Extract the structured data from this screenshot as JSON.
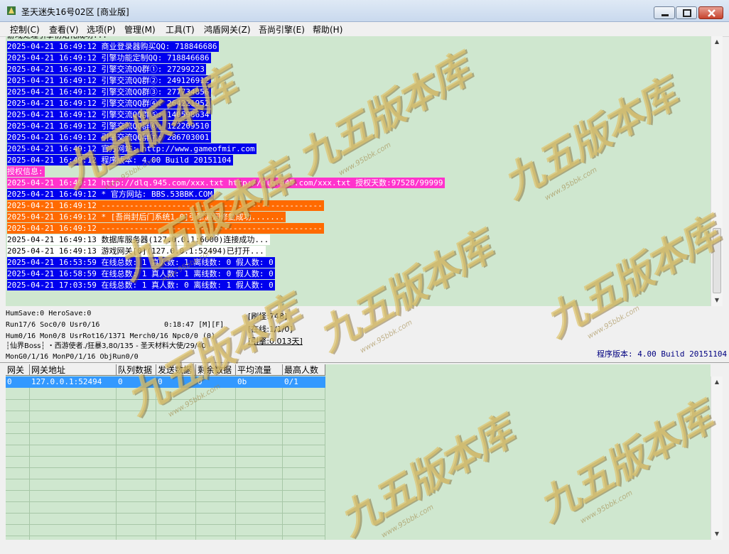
{
  "window": {
    "title": "圣天迷失16号02区 [商业版]"
  },
  "menu": [
    "控制(C)",
    "查看(V)",
    "选项(P)",
    "管理(M)",
    "工具(T)",
    "鸿盾网关(Z)",
    "吾尚引擎(E)",
    "帮助(H)"
  ],
  "log": [
    {
      "text": "游戏处理引擎初始化成功...",
      "bg": "#cfe7cf",
      "fg": "#000000",
      "cut": true
    },
    {
      "text": "2025-04-21 16:49:12 商业登录器购买QQ: 718846686",
      "bg": "#0000ee",
      "fg": "#ffffff"
    },
    {
      "text": "2025-04-21 16:49:12 引擎功能定制QQ: 718846686",
      "bg": "#0000ee",
      "fg": "#ffffff"
    },
    {
      "text": "2025-04-21 16:49:12 引擎交流QQ群①: 27299223",
      "bg": "#0000ee",
      "fg": "#ffffff"
    },
    {
      "text": "2025-04-21 16:49:12 引擎交流QQ群②: 249126912",
      "bg": "#0000ee",
      "fg": "#ffffff"
    },
    {
      "text": "2025-04-21 16:49:12 引擎交流QQ群③: 277734856",
      "bg": "#0000ee",
      "fg": "#ffffff"
    },
    {
      "text": "2025-04-21 16:49:12 引擎交流QQ群④: 264221952",
      "bg": "#0000ee",
      "fg": "#ffffff"
    },
    {
      "text": "2025-04-21 16:49:12 引擎交流QQ群⑤: 140598634",
      "bg": "#0000ee",
      "fg": "#ffffff"
    },
    {
      "text": "2025-04-21 16:49:12 引擎交流QQ群⑥: 122209510",
      "bg": "#0000ee",
      "fg": "#ffffff"
    },
    {
      "text": "2025-04-21 16:49:12 引擎交流QQ群⑦: 286703001",
      "bg": "#0000ee",
      "fg": "#ffffff"
    },
    {
      "text": "2025-04-21 16:49:12 官方网站: http://www.gameofmir.com",
      "bg": "#0000ee",
      "fg": "#ffffff"
    },
    {
      "text": "2025-04-21 16:49:12 程序版本: 4.00 Build 20151104",
      "bg": "#0000ee",
      "fg": "#ffffff"
    },
    {
      "text": "授权信息:",
      "bg": "#ff33cc",
      "fg": "#ffffff"
    },
    {
      "text": "2025-04-21 16:49:12 http://dlq.945.com/xxx.txt http://dlq.945.com/xxx.txt 授权天数:97528/99999",
      "bg": "#ff33cc",
      "fg": "#ffffff"
    },
    {
      "text": "2025-04-21 16:49:12 * 官方网站: BBS.53BBK.COM",
      "bg": "#0000ee",
      "fg": "#ffffff"
    },
    {
      "text": "2025-04-21 16:49:12 -----------------------------------------------",
      "bg": "#ff6a00",
      "fg": "#ffffff"
    },
    {
      "text": "2025-04-21 16:49:12 * [吾尚封后门系统1.0]引擎漏洞修复成功.......",
      "bg": "#ff6a00",
      "fg": "#ffffff"
    },
    {
      "text": "2025-04-21 16:49:12 -----------------------------------------------",
      "bg": "#ff6a00",
      "fg": "#ffffff"
    },
    {
      "text": "2025-04-21 16:49:13 数据库服务器(127.0.0.1:6000)连接成功...",
      "bg": "#ffffff",
      "fg": "#000000"
    },
    {
      "text": "2025-04-21 16:49:13 游戏网关[0](127.0.0.1:52494)已打开...",
      "bg": "#ffffff",
      "fg": "#000000"
    },
    {
      "text": "2025-04-21 16:53:59 在线总数: 1 真人数: 1 离线数: 0 假人数: 0",
      "bg": "#0000ee",
      "fg": "#ffffff"
    },
    {
      "text": "2025-04-21 16:58:59 在线总数: 1 真人数: 1 离线数: 0 假人数: 0",
      "bg": "#0000ee",
      "fg": "#ffffff"
    },
    {
      "text": "2025-04-21 17:03:59 在线总数: 1 真人数: 0 离线数: 1 假人数: 0",
      "bg": "#0000ee",
      "fg": "#ffffff"
    }
  ],
  "status": {
    "line1": "HumSave:0 HeroSave:0",
    "line2": "Run17/6 Soc0/0 Usr0/16",
    "time": "0:18:47 [M][F]",
    "line3": "Hum0/16 Mon0/8 UsrRot16/1371 Merch0/16 Npc0/0 (0)",
    "line4": "┆仙界Boss┆ ・西游使者./狂暴3,80/135 - 圣天材料大使/29/40",
    "line5": "MonG0/1/16 MonP0/1/16 ObjRun0/0",
    "refresh": "[刷怪:748]",
    "online": "[在线:1/1/0]",
    "engine": "[引擎:0.013天]",
    "version": "程序版本: 4.00 Build 20151104"
  },
  "grid": {
    "columns": [
      "网关",
      "网关地址",
      "队列数据",
      "发送数据",
      "剩余数据",
      "平均流量",
      "最高人数"
    ],
    "rows": [
      [
        "0",
        "127.0.0.1:52494",
        "0",
        "0",
        "0",
        "0b",
        "0/1"
      ]
    ]
  },
  "watermark": {
    "text": "九五版本库",
    "url": "www.95bbk.com"
  },
  "colors": {
    "log_bg": "#cfe7cf",
    "selected_row": "#3399ff"
  }
}
